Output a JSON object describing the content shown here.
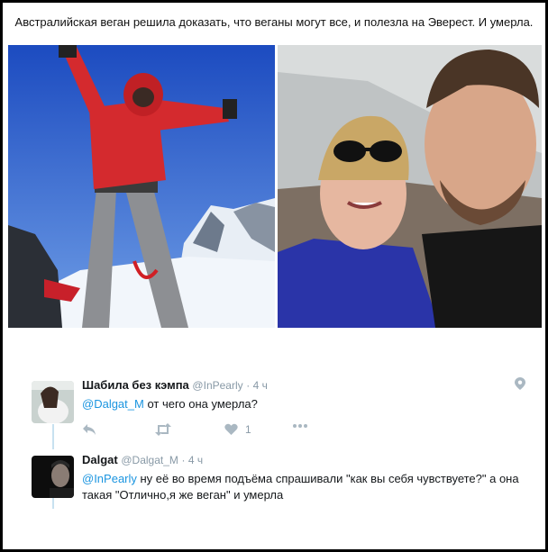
{
  "caption": "Австралийская веган решила доказать, что веганы могут все, и полезла на Эверест. И умерла.",
  "tweets": [
    {
      "name": "Шабила без кэмпа",
      "handle": "@InPearly",
      "time": "· 4 ч",
      "mention": "@Dalgat_M",
      "text": " от чего она умерла?",
      "likes": "1"
    },
    {
      "name": "Dalgat",
      "handle": "@Dalgat_M",
      "time": "· 4 ч",
      "mention": "@InPearly",
      "text": " ну её во время подъёма спрашивали \"как вы себя чувствуете?\" а она такая \"Отлично,я же веган\" и умерла"
    }
  ],
  "icons": {
    "reply": "reply-icon",
    "retweet": "retweet-icon",
    "like": "heart-icon",
    "more": "more-icon",
    "location": "location-pin-icon"
  },
  "colors": {
    "mention": "#1b95e0",
    "muted": "#8899a6"
  }
}
